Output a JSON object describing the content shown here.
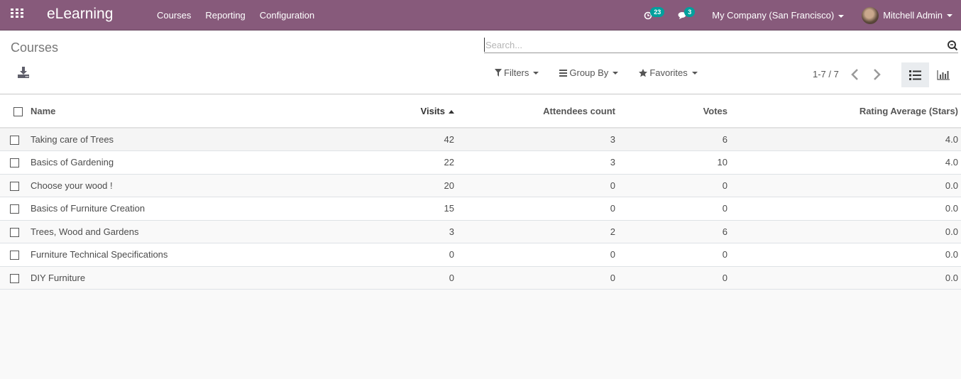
{
  "navbar": {
    "app_name": "eLearning",
    "menu": [
      "Courses",
      "Reporting",
      "Configuration"
    ],
    "activity_count": "23",
    "messages_count": "3",
    "company": "My Company (San Francisco)",
    "user": "Mitchell Admin",
    "brand_color": "#875a7b",
    "badge_color": "#00a09d"
  },
  "control_panel": {
    "breadcrumb": "Courses",
    "search_placeholder": "Search...",
    "filters_label": "Filters",
    "group_by_label": "Group By",
    "favorites_label": "Favorites",
    "pager": "1-7 / 7"
  },
  "table": {
    "columns": [
      "Name",
      "Visits",
      "Attendees count",
      "Votes",
      "Rating Average (Stars)"
    ],
    "sorted_column": "Visits",
    "rows": [
      {
        "name": "Taking care of Trees",
        "visits": "42",
        "attendees": "3",
        "votes": "6",
        "rating": "4.0"
      },
      {
        "name": "Basics of Gardening",
        "visits": "22",
        "attendees": "3",
        "votes": "10",
        "rating": "4.0"
      },
      {
        "name": "Choose your wood !",
        "visits": "20",
        "attendees": "0",
        "votes": "0",
        "rating": "0.0"
      },
      {
        "name": "Basics of Furniture Creation",
        "visits": "15",
        "attendees": "0",
        "votes": "0",
        "rating": "0.0"
      },
      {
        "name": "Trees, Wood and Gardens",
        "visits": "3",
        "attendees": "2",
        "votes": "6",
        "rating": "0.0"
      },
      {
        "name": "Furniture Technical Specifications",
        "visits": "0",
        "attendees": "0",
        "votes": "0",
        "rating": "0.0"
      },
      {
        "name": "DIY Furniture",
        "visits": "0",
        "attendees": "0",
        "votes": "0",
        "rating": "0.0"
      }
    ]
  }
}
